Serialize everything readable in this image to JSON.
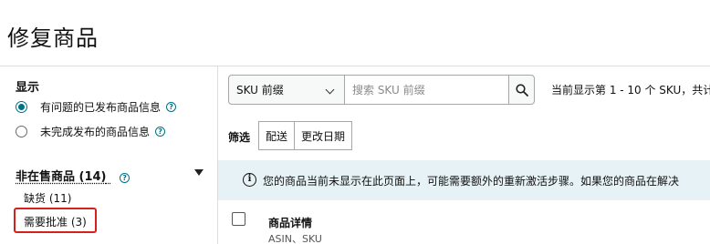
{
  "page": {
    "title": "修复商品"
  },
  "sidebar": {
    "show_heading": "显示",
    "options": [
      {
        "label": "有问题的已发布商品信息",
        "checked": true
      },
      {
        "label": "未完成发布的商品信息",
        "checked": false
      }
    ],
    "help_glyph": "?",
    "inactive_heading": "非在售商品 (14)",
    "inactive_items": [
      {
        "label": "缺货 (11)"
      },
      {
        "label": "需要批准 (3)",
        "highlighted": true
      }
    ]
  },
  "search": {
    "field_select": "SKU 前缀",
    "placeholder": "搜索 SKU 前缀",
    "result_text": "当前显示第 1 - 10 个 SKU，共计"
  },
  "filters": {
    "label": "筛选",
    "buttons": [
      "配送",
      "更改日期"
    ]
  },
  "info": {
    "icon_glyph": "i",
    "text": "您的商品当前未显示在此页面上，可能需要额外的重新激活步骤。如果您的商品在解决"
  },
  "table": {
    "header": "商品详情",
    "subheader": "ASIN、SKU"
  },
  "colors": {
    "accent": "#007185",
    "highlight_border": "#d6201b",
    "info_bg": "#e6f2f5"
  }
}
